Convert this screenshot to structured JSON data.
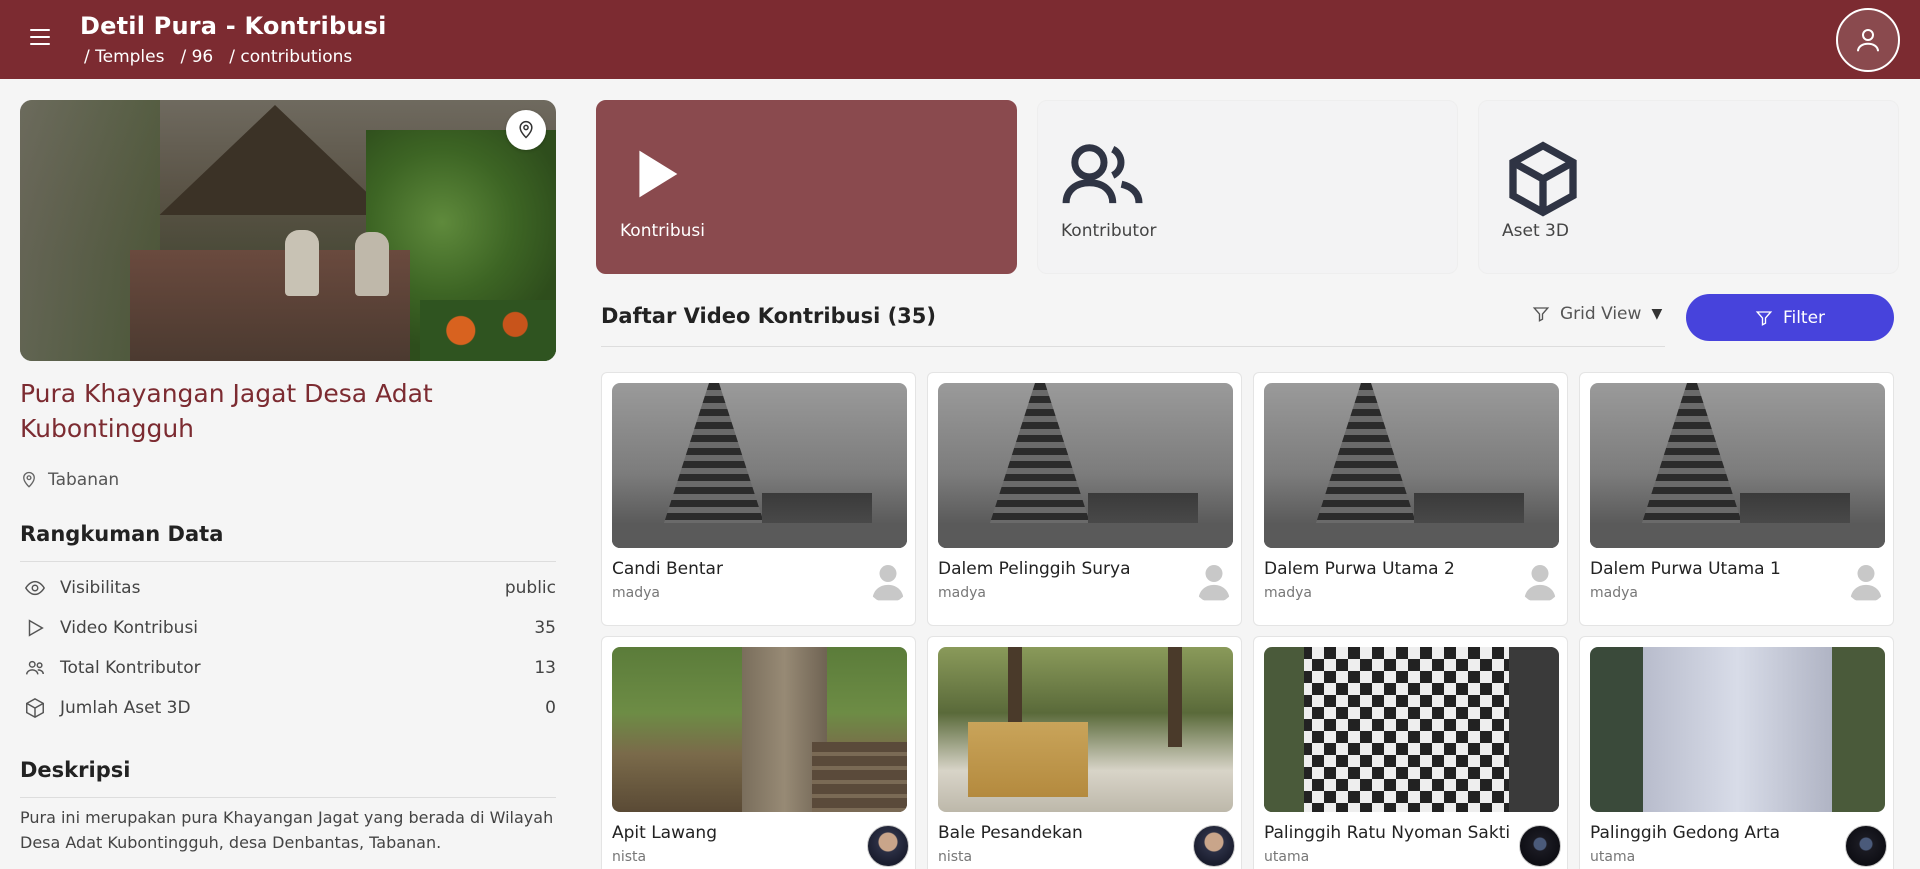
{
  "header": {
    "title": "Detil Pura - Kontribusi",
    "breadcrumb": [
      "/ Temples",
      "/ 96",
      "/ contributions"
    ]
  },
  "temple": {
    "name": "Pura Khayangan Jagat Desa Adat Kubontingguh",
    "location": "Tabanan"
  },
  "summary": {
    "heading": "Rangkuman Data",
    "rows": [
      {
        "label": "Visibilitas",
        "value": "public",
        "icon": "eye-icon"
      },
      {
        "label": "Video Kontribusi",
        "value": "35",
        "icon": "play-icon"
      },
      {
        "label": "Total Kontributor",
        "value": "13",
        "icon": "users-icon"
      },
      {
        "label": "Jumlah Aset 3D",
        "value": "0",
        "icon": "cube-icon"
      }
    ]
  },
  "description": {
    "heading": "Deskripsi",
    "text": "Pura ini merupakan pura Khayangan Jagat yang berada di Wilayah Desa Adat Kubontingguh, desa Denbantas, Tabanan."
  },
  "tabs": [
    {
      "label": "Kontribusi",
      "icon": "play-icon",
      "active": true
    },
    {
      "label": "Kontributor",
      "icon": "users-icon",
      "active": false
    },
    {
      "label": "Aset 3D",
      "icon": "cube-icon",
      "active": false
    }
  ],
  "list": {
    "title": "Daftar Video Kontribusi (35)",
    "view_label": "Grid View",
    "filter_label": "Filter"
  },
  "videos": [
    {
      "title": "Candi Bentar",
      "level": "madya",
      "thumb": "pagoda",
      "avatar": "gray"
    },
    {
      "title": "Dalem Pelinggih Surya",
      "level": "madya",
      "thumb": "pagoda",
      "avatar": "gray"
    },
    {
      "title": "Dalem Purwa Utama 2",
      "level": "madya",
      "thumb": "pagoda",
      "avatar": "gray"
    },
    {
      "title": "Dalem Purwa Utama 1",
      "level": "madya",
      "thumb": "pagoda",
      "avatar": "gray"
    },
    {
      "title": "Apit Lawang",
      "level": "nista",
      "thumb": "trees",
      "avatar": "photo"
    },
    {
      "title": "Bale Pesandekan",
      "level": "nista",
      "thumb": "bale",
      "avatar": "photo"
    },
    {
      "title": "Palinggih Ratu Nyoman Sakti",
      "level": "utama",
      "thumb": "check",
      "avatar": "dark"
    },
    {
      "title": "Palinggih Gedong Arta",
      "level": "utama",
      "thumb": "cloth",
      "avatar": "dark"
    }
  ],
  "colors": {
    "brand": "#7c2b31",
    "active_tab": "#8a4a4e",
    "filter": "#4743dc"
  }
}
